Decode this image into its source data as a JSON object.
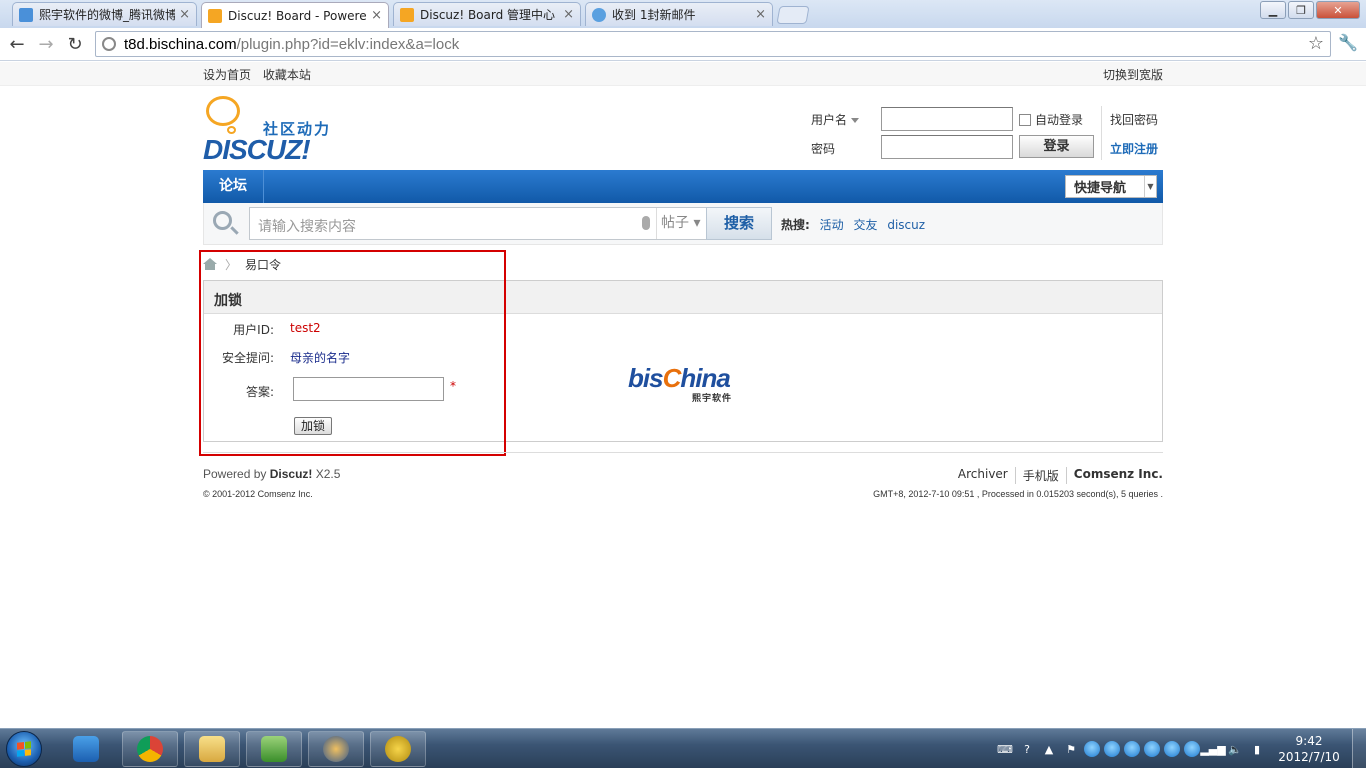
{
  "browser": {
    "tabs": [
      {
        "title": "熙宇软件的微博_腾讯微博",
        "favicon_color": "#4a90d9",
        "active": false
      },
      {
        "title": "Discuz! Board - Powered",
        "favicon_color": "#f5a623",
        "active": true
      },
      {
        "title": "Discuz! Board 管理中心",
        "favicon_color": "#f5a623",
        "active": false
      },
      {
        "title": "收到 1封新邮件",
        "favicon_color": "#5aa0e0",
        "active": false
      }
    ],
    "tab_close_glyph": "×",
    "url_host": "t8d.bischina.com",
    "url_path": "/plugin.php?id=eklv:index&a=lock"
  },
  "site": {
    "topbar": {
      "set_home": "设为首页",
      "bookmark": "收藏本站",
      "switch_wide": "切换到宽版"
    },
    "logo": {
      "slogan": "社区动力",
      "brand": "DISCUZ!"
    },
    "login": {
      "username_label": "用户名",
      "password_label": "密码",
      "auto_login": "自动登录",
      "submit": "登录",
      "lost_password": "找回密码",
      "register": "立即注册"
    },
    "nav": {
      "forum": "论坛",
      "quick_nav": "快捷导航"
    },
    "search": {
      "placeholder": "请输入搜索内容",
      "type": "帖子",
      "button": "搜索",
      "hot_label": "热搜:",
      "hot_items": [
        "活动",
        "交友",
        "discuz"
      ]
    },
    "breadcrumb": {
      "separator": "〉",
      "current": "易口令"
    },
    "panel": {
      "title": "加锁",
      "user_id_label": "用户ID:",
      "user_id_value": "test2",
      "question_label": "安全提问:",
      "question_value": "母亲的名字",
      "answer_label": "答案:",
      "required_mark": "*",
      "lock_button": "加锁",
      "partner_logo_main": "bis",
      "partner_logo_c": "C",
      "partner_logo_tail": "hina",
      "partner_logo_sub": "熙宇软件"
    },
    "footer": {
      "powered_prefix": "Powered by",
      "powered_brand": "Discuz!",
      "powered_version": "X2.5",
      "copyright": "© 2001-2012 Comsenz Inc.",
      "links": [
        "Archiver",
        "手机版",
        "Comsenz Inc."
      ],
      "processed": "GMT+8, 2012-7-10 09:51 , Processed in 0.015203 second(s), 5 queries ."
    }
  },
  "taskbar": {
    "time": "9:42",
    "date": "2012/7/10"
  }
}
